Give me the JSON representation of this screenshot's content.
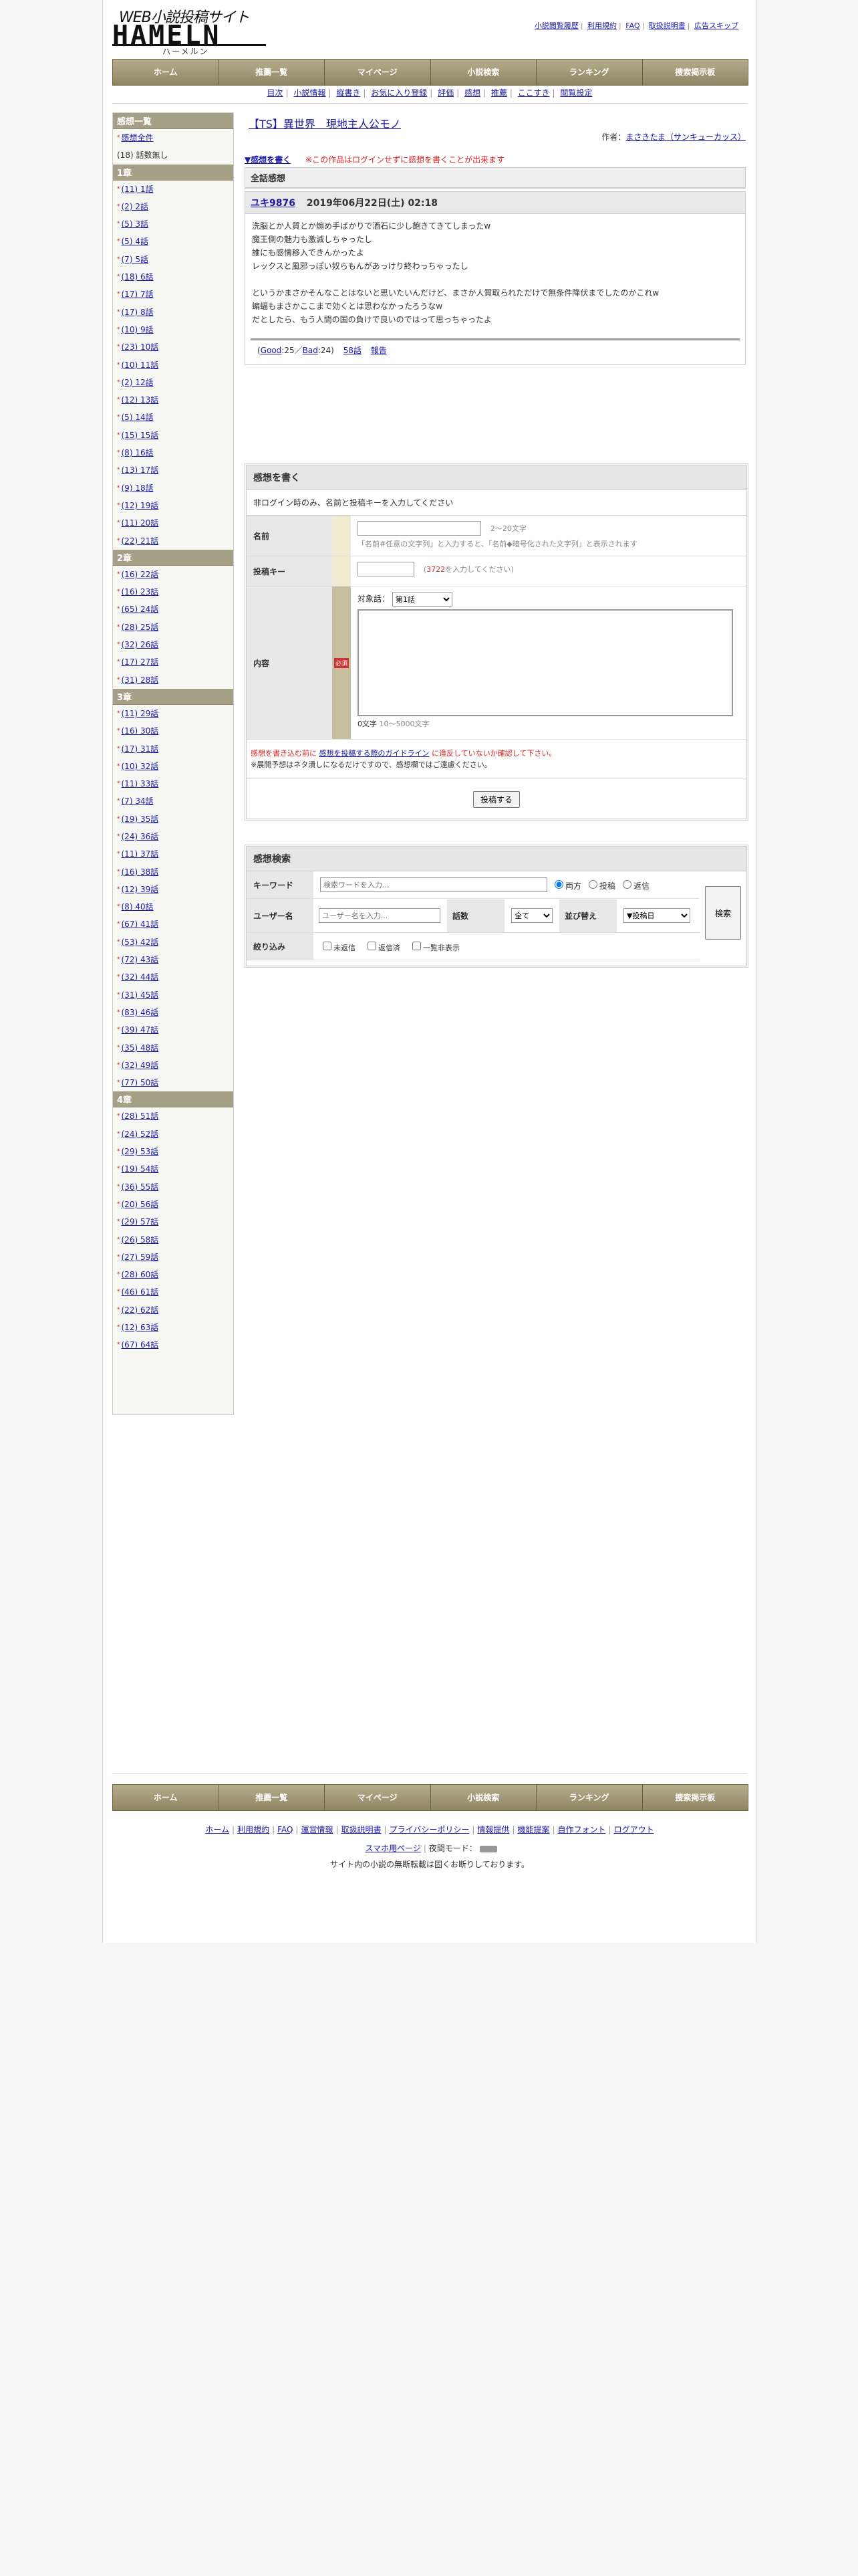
{
  "logo": {
    "top": "WEB小説投稿サイト",
    "big": "HAMELN",
    "sub": "ハーメルン"
  },
  "toplinks": [
    "小説閲覧履歴",
    "利用規約",
    "FAQ",
    "取扱説明書",
    "広告スキップ"
  ],
  "nav": [
    "ホーム",
    "推薦一覧",
    "マイページ",
    "小説検索",
    "ランキング",
    "捜索掲示板"
  ],
  "subnav": [
    "目次",
    "小説情報",
    "縦書き",
    "お気に入り登録",
    "評価",
    "感想",
    "推薦",
    "ここすき",
    "閲覧設定"
  ],
  "sidebar": {
    "head": "感想一覧",
    "all": "感想全件",
    "nostory": "(18) 話数無し",
    "chapters": [
      {
        "title": "1章",
        "items": [
          "(11) 1話",
          "(2) 2話",
          "(5) 3話",
          "(5) 4話",
          "(7) 5話",
          "(18) 6話",
          "(17) 7話",
          "(17) 8話",
          "(10) 9話",
          "(23) 10話",
          "(10) 11話",
          "(2) 12話",
          "(12) 13話",
          "(5) 14話",
          "(15) 15話",
          "(8) 16話",
          "(13) 17話",
          "(9) 18話",
          "(12) 19話",
          "(11) 20話",
          "(22) 21話"
        ]
      },
      {
        "title": "2章",
        "items": [
          "(16) 22話",
          "(16) 23話",
          "(65) 24話",
          "(28) 25話",
          "(32) 26話",
          "(17) 27話",
          "(31) 28話"
        ]
      },
      {
        "title": "3章",
        "items": [
          "(11) 29話",
          "(16) 30話",
          "(17) 31話",
          "(10) 32話",
          "(11) 33話",
          "(7) 34話",
          "(19) 35話",
          "(24) 36話",
          "(11) 37話",
          "(16) 38話",
          "(12) 39話",
          "(8) 40話",
          "(67) 41話",
          "(53) 42話",
          "(72) 43話",
          "(32) 44話",
          "(31) 45話",
          "(83) 46話",
          "(39) 47話",
          "(35) 48話",
          "(32) 49話",
          "(77) 50話"
        ]
      },
      {
        "title": "4章",
        "items": [
          "(28) 51話",
          "(24) 52話",
          "(29) 53話",
          "(19) 54話",
          "(36) 55話",
          "(20) 56話",
          "(29) 57話",
          "(26) 58話",
          "(27) 59話",
          "(28) 60話",
          "(46) 61話",
          "(22) 62話",
          "(12) 63話",
          "(67) 64話"
        ]
      }
    ]
  },
  "main": {
    "title": "【TS】異世界　現地主人公モノ",
    "author_label": "作者：",
    "author": "まさきたま（サンキューカッス）",
    "notice_link": "▼感想を書く",
    "notice_red": "※この作品はログインせずに感想を書くことが出来ます",
    "section": "全話感想",
    "comment": {
      "user": "ユキ9876",
      "date": "2019年06月22日(土) 02:18",
      "lines": [
        "洗脳とか人質とか煽め手ばかりで酒石に少し飽きてきてしまったw",
        "魔王側の魅力も激減しちゃったし",
        "誰にも感情移入できんかったよ",
        "レックスと風邪っぽい奴らもんがあっけり終わっちゃったし",
        "",
        "というかまさかそんなことはないと思いたいんだけど、まさか人質取られただけで無条件降伏までしたのかこれw",
        "蝙蝠もまさかここまで効くとは思わなかったろうなw",
        "だとしたら、もう人間の国の負けで良いのではって思っちゃったよ"
      ],
      "good_label": "Good",
      "good": "25",
      "bad_label": "Bad",
      "bad": "24",
      "story": "58話",
      "report": "報告"
    }
  },
  "form": {
    "head": "感想を書く",
    "intro": "非ログイン時のみ、名前と投稿キーを入力してください",
    "name_label": "名前",
    "name_hint": "2〜20文字",
    "name_note": "「名前#任意の文字列」と入力すると、「名前◆暗号化された文字列」と表示されます",
    "key_label": "投稿キー",
    "key_code": "3722",
    "key_hint": "を入力してください",
    "content_label": "内容",
    "required": "必須",
    "target_label": "対象話：",
    "target_value": "第1話",
    "count": "0文字",
    "count_range": "10〜5000文字",
    "warn1": "感想を書き込む前に",
    "warn_link": "感想を投稿する際のガイドライン",
    "warn2": "に違反していないか確認して下さい。",
    "warn3": "※展開予想はネタ潰しになるだけですので、感想欄ではご遠慮ください。",
    "submit": "投稿する"
  },
  "search": {
    "head": "感想検索",
    "keyword_label": "キーワード",
    "keyword_placeholder": "検索ワードを入力...",
    "radio": [
      "両方",
      "投稿",
      "返信"
    ],
    "user_label": "ユーザー名",
    "user_placeholder": "ユーザー名を入力...",
    "story_label": "話数",
    "story_value": "全て",
    "sort_label": "並び替え",
    "sort_value": "▼投稿日",
    "filter_label": "絞り込み",
    "filters": [
      "未返信",
      "返信済",
      "一覧非表示"
    ],
    "button": "検索"
  },
  "footer": {
    "links": [
      "ホーム",
      "利用規約",
      "FAQ",
      "運営情報",
      "取扱説明書",
      "プライバシーポリシー",
      "情報提供",
      "機能提案",
      "自作フォント",
      "ログアウト"
    ],
    "mobile": "スマホ用ページ",
    "night": "夜間モード：",
    "copyright": "サイト内の小説の無断転載は固くお断りしております。"
  }
}
